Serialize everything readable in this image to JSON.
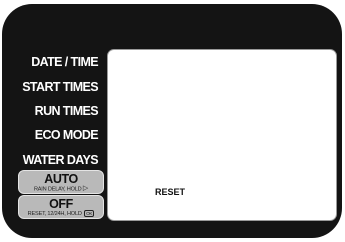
{
  "menu": [
    {
      "id": "date-time",
      "label": "DATE / TIME"
    },
    {
      "id": "start-times",
      "label": "START TIMES"
    },
    {
      "id": "run-times",
      "label": "RUN TIMES"
    },
    {
      "id": "eco-mode",
      "label": "ECO MODE"
    },
    {
      "id": "water-days",
      "label": "WATER DAYS"
    }
  ],
  "buttons": {
    "auto": {
      "label": "AUTO",
      "hint": "RAIN DELAY, HOLD",
      "hint_icon": "play-icon"
    },
    "off": {
      "label": "OFF",
      "hint": "RESET, 12/24H, HOLD",
      "hint_icon_text": "OK"
    }
  },
  "display": {
    "text": "RESET"
  },
  "colors": {
    "panel": "#141414",
    "button": "#b9b9b9",
    "screen": "#ffffff"
  }
}
